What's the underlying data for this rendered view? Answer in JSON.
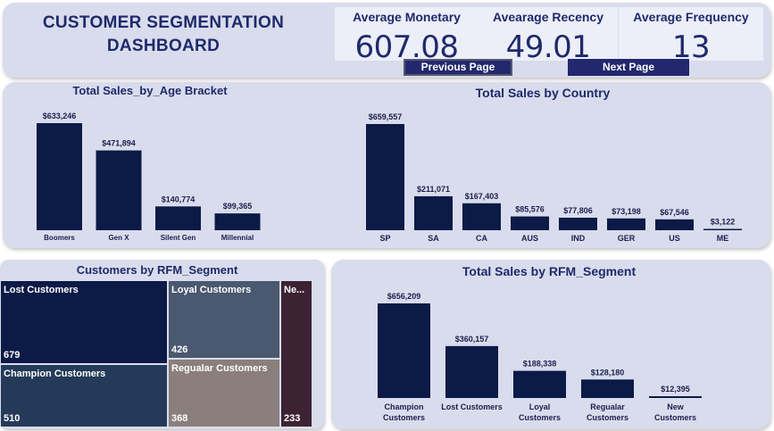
{
  "header": {
    "title_line1": "CUSTOMER SEGMENTATION",
    "title_line2": "DASHBOARD",
    "kpis": [
      {
        "label": "Average Monetary",
        "value": "607.08"
      },
      {
        "label": "Avearage Recency",
        "value": "49.01"
      },
      {
        "label": "Average Frequency",
        "value": "13"
      }
    ],
    "prev_label": "Previous Page",
    "next_label": "Next Page"
  },
  "colors": {
    "bar": "#0c1a47",
    "title": "#1f2a6b",
    "panel": "#d9dcec"
  },
  "chart_data": [
    {
      "type": "bar",
      "title": "Total Sales_by_Age Bracket",
      "categories": [
        "Boomers",
        "Gen X",
        "Silent Gen",
        "Millennial"
      ],
      "values": [
        633246,
        471894,
        140774,
        99365
      ],
      "labels": [
        "$633,246",
        "$471,894",
        "$140,774",
        "$99,365"
      ]
    },
    {
      "type": "bar",
      "title": "Total Sales by Country",
      "categories": [
        "SP",
        "SA",
        "CA",
        "AUS",
        "IND",
        "GER",
        "US",
        "ME"
      ],
      "values": [
        659557,
        211071,
        167403,
        85576,
        77806,
        73198,
        67546,
        3122
      ],
      "labels": [
        "$659,557",
        "$211,071",
        "$167,403",
        "$85,576",
        "$77,806",
        "$73,198",
        "$67,546",
        "$3,122"
      ]
    },
    {
      "type": "treemap",
      "title": "Customers by RFM_Segment",
      "categories": [
        "Lost Customers",
        "Loyal Customers",
        "Ne...",
        "Champion Customers",
        "Regualar Customers"
      ],
      "values": [
        679,
        426,
        233,
        510,
        368
      ],
      "colors": [
        "#0c1a47",
        "#4a5870",
        "#3c2233",
        "#243a58",
        "#8a7f7c"
      ]
    },
    {
      "type": "bar",
      "title": "Total Sales by RFM_Segment",
      "categories": [
        [
          "Champion",
          "Customers"
        ],
        [
          "Lost Customers"
        ],
        [
          "Loyal",
          "Customers"
        ],
        [
          "Regualar",
          "Customers"
        ],
        [
          "New",
          "Customers"
        ]
      ],
      "values": [
        656209,
        360157,
        188338,
        128180,
        12395
      ],
      "labels": [
        "$656,209",
        "$360,157",
        "$188,338",
        "$128,180",
        "$12,395"
      ]
    }
  ]
}
